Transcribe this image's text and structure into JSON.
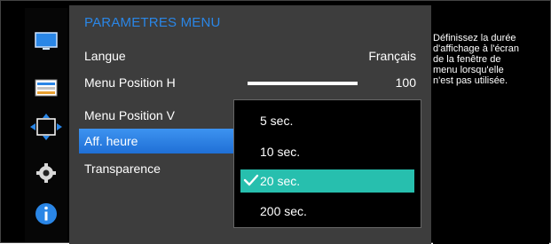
{
  "menu": {
    "title": "PARAMETRES MENU",
    "items": [
      {
        "label": "Langue",
        "value": "Français"
      },
      {
        "label": "Menu Position H",
        "value": "100",
        "level": 1.0
      },
      {
        "label": "Menu Position V",
        "value": ""
      },
      {
        "label": "Aff. heure",
        "value": "",
        "selected": true
      },
      {
        "label": "Transparence",
        "value": ""
      }
    ]
  },
  "dropdown": {
    "options": [
      {
        "label": "5 sec.",
        "selected": false
      },
      {
        "label": "10 sec.",
        "selected": false
      },
      {
        "label": "20 sec.",
        "selected": true
      },
      {
        "label": "200 sec.",
        "selected": false
      }
    ]
  },
  "help": {
    "lines": [
      "Définissez la durée",
      "d'affichage à l'écran",
      "de la fenêtre de",
      "menu lorsqu'elle",
      "n'est pas utilisée."
    ]
  },
  "sidebar": {
    "icons": [
      "monitor-icon",
      "color-icon",
      "size-position-icon",
      "settings-icon",
      "info-icon"
    ],
    "selected_index": 2
  },
  "colors": {
    "accent_blue": "#2a86e6",
    "selected_teal": "#27bfae",
    "panel_gray": "#3d3d3d"
  }
}
